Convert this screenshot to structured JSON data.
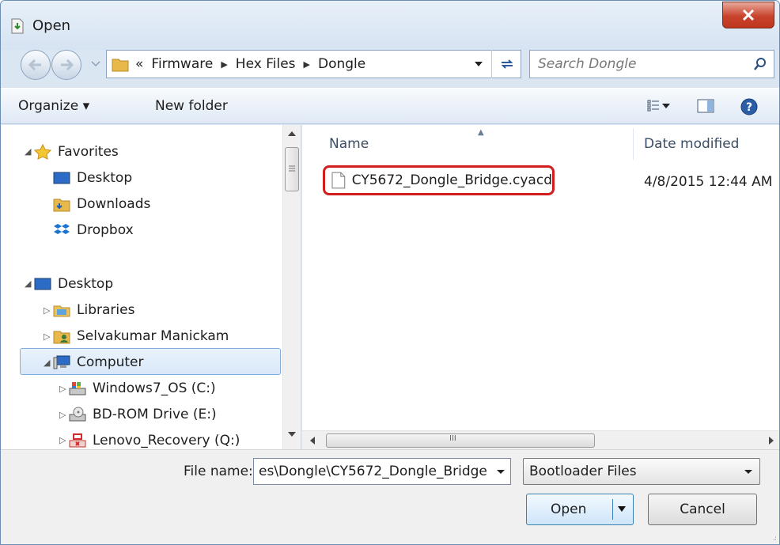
{
  "window": {
    "title": "Open"
  },
  "address": {
    "overflow_marker": "«",
    "breadcrumbs": [
      "Firmware",
      "Hex Files",
      "Dongle"
    ],
    "search_placeholder": "Search Dongle"
  },
  "toolbar": {
    "organize_label": "Organize ▾",
    "new_folder_label": "New folder"
  },
  "navpane": {
    "items": [
      {
        "label": "Favorites",
        "icon": "star-icon"
      },
      {
        "label": "Desktop",
        "icon": "desktop-icon"
      },
      {
        "label": "Downloads",
        "icon": "downloads-folder-icon"
      },
      {
        "label": "Dropbox",
        "icon": "dropbox-icon"
      },
      {
        "label": "Desktop",
        "icon": "desktop-icon"
      },
      {
        "label": "Libraries",
        "icon": "libraries-icon"
      },
      {
        "label": "Selvakumar Manickam",
        "icon": "user-folder-icon"
      },
      {
        "label": "Computer",
        "icon": "computer-icon"
      },
      {
        "label": "Windows7_OS (C:)",
        "icon": "windows-drive-icon"
      },
      {
        "label": "BD-ROM Drive (E:)",
        "icon": "optical-drive-icon"
      },
      {
        "label": "Lenovo_Recovery (Q:)",
        "icon": "recovery-drive-icon"
      }
    ],
    "selected": "Computer"
  },
  "filelist": {
    "columns": {
      "name": "Name",
      "date": "Date modified"
    },
    "rows": [
      {
        "name": "CY5672_Dongle_Bridge.cyacd",
        "date": "4/8/2015 12:44 AM"
      }
    ],
    "scroll_marker": "III"
  },
  "bottom": {
    "file_name_label": "File name:",
    "file_name_value": "es\\Dongle\\CY5672_Dongle_Bridge",
    "file_type_value": "Bootloader Files",
    "open_label": "Open",
    "cancel_label": "Cancel"
  },
  "colors": {
    "highlight_border": "#d11f1f",
    "selection": "#d8e7f8",
    "chrome": "#dbe6f3"
  }
}
